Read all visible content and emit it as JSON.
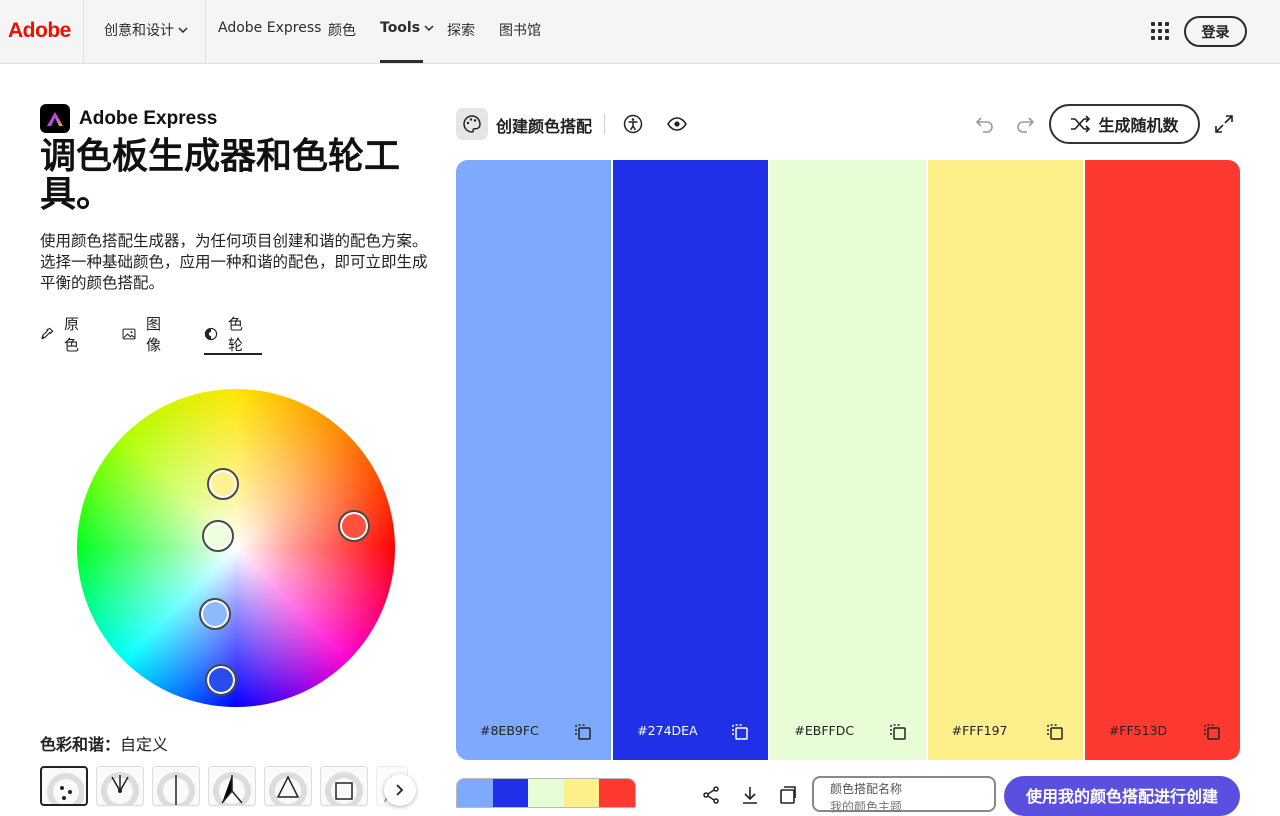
{
  "nav": {
    "logo": "Adobe",
    "items": [
      {
        "label": "创意和设计",
        "dropdown": true
      },
      {
        "label": "Adobe Express"
      },
      {
        "label": "颜色"
      },
      {
        "label": "Tools",
        "dropdown": true,
        "active": true
      },
      {
        "label": "探索"
      },
      {
        "label": "图书馆"
      }
    ],
    "login": "登录"
  },
  "brand": {
    "name": "Adobe Express"
  },
  "page": {
    "title": "调色板生成器和色轮工具。",
    "description": "使用颜色搭配生成器，为任何项目创建和谐的配色方案。选择一种基础颜色，应用一种和谐的配色，即可立即生成平衡的颜色搭配。"
  },
  "modes": [
    {
      "label": "原色",
      "icon": "eyedropper-icon"
    },
    {
      "label": "图像",
      "icon": "image-icon"
    },
    {
      "label": "色轮",
      "icon": "color-wheel-icon",
      "active": true
    }
  ],
  "wheel": {
    "handles": [
      {
        "color": "#FFF197"
      },
      {
        "color": "#EBFFDC"
      },
      {
        "color": "#FF513D"
      },
      {
        "color": "#8EB9FC"
      },
      {
        "color": "#274DEA"
      }
    ]
  },
  "harmony": {
    "label": "色彩和谐：",
    "value": "自定义"
  },
  "toolbar": {
    "title": "创建颜色搭配",
    "random": "生成随机数"
  },
  "swatches": [
    {
      "hex": "#8EB9FC",
      "color": "#7fa9fc"
    },
    {
      "hex": "#274DEA",
      "color": "#1f30e6"
    },
    {
      "hex": "#EBFFDC",
      "color": "#e6fdd6"
    },
    {
      "hex": "#FFF197",
      "color": "#fdf08a"
    },
    {
      "hex": "#FF513D",
      "color": "#fe3a30"
    }
  ],
  "bottom": {
    "name_label": "颜色搭配名称",
    "name_placeholder": "我的颜色主题",
    "use_button": "使用我的颜色搭配进行创建"
  }
}
